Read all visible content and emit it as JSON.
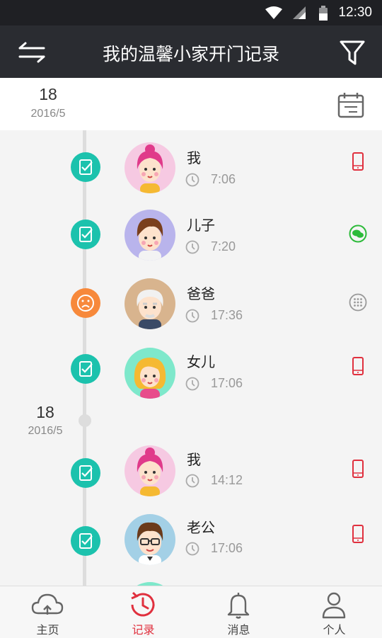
{
  "status_bar": {
    "time": "12:30"
  },
  "app_bar": {
    "title": "我的温馨小家开门记录"
  },
  "date_header": {
    "day": "18",
    "year_month": "2016/5"
  },
  "groups": [
    {
      "day": "18",
      "year_month": "2016/5"
    }
  ],
  "records": [
    {
      "name": "我",
      "time": "7:06",
      "status": "success",
      "avatar": "woman-pink-hair-avatar",
      "method": "phone-icon"
    },
    {
      "name": "儿子",
      "time": "7:20",
      "status": "success",
      "avatar": "boy-avatar",
      "method": "wechat-icon"
    },
    {
      "name": "爸爸",
      "time": "17:36",
      "status": "failed",
      "avatar": "grandpa-avatar",
      "method": "keypad-icon"
    },
    {
      "name": "女儿",
      "time": "17:06",
      "status": "success",
      "avatar": "girl-blonde-avatar",
      "method": "phone-icon"
    },
    {
      "name": "我",
      "time": "14:12",
      "status": "success",
      "avatar": "woman-pink-hair-avatar",
      "method": "phone-icon"
    },
    {
      "name": "老公",
      "time": "17:06",
      "status": "success",
      "avatar": "man-glasses-avatar",
      "method": "phone-icon"
    }
  ],
  "tabs": [
    {
      "label": "主页",
      "icon": "cloud-icon",
      "active": false
    },
    {
      "label": "记录",
      "icon": "history-icon",
      "active": true
    },
    {
      "label": "消息",
      "icon": "bell-icon",
      "active": false
    },
    {
      "label": "个人",
      "icon": "user-icon",
      "active": false
    }
  ],
  "colors": {
    "success": "#1cc2ad",
    "failed": "#f7893b",
    "accent": "#e0303e",
    "wechat": "#2dba3a"
  }
}
